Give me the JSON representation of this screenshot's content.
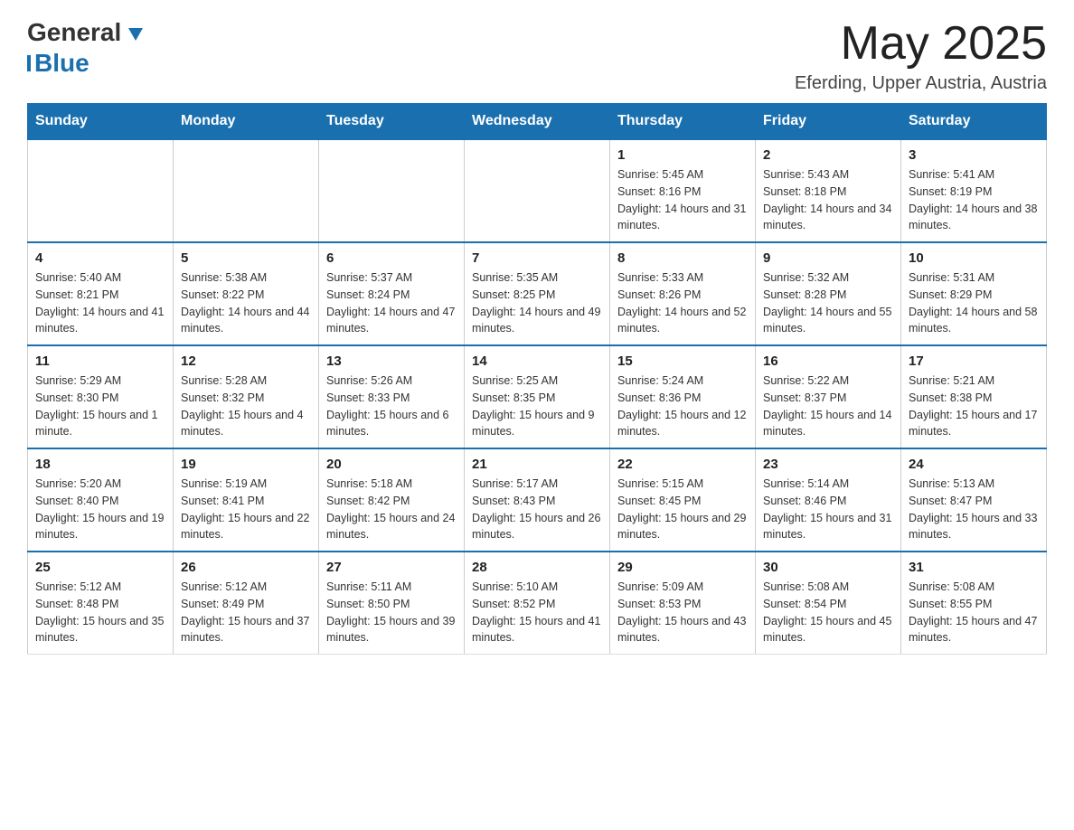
{
  "header": {
    "logo_text_black": "General",
    "logo_text_blue": "Blue",
    "month_title": "May 2025",
    "location": "Eferding, Upper Austria, Austria"
  },
  "days_of_week": [
    "Sunday",
    "Monday",
    "Tuesday",
    "Wednesday",
    "Thursday",
    "Friday",
    "Saturday"
  ],
  "weeks": [
    [
      {
        "day": "",
        "info": ""
      },
      {
        "day": "",
        "info": ""
      },
      {
        "day": "",
        "info": ""
      },
      {
        "day": "",
        "info": ""
      },
      {
        "day": "1",
        "info": "Sunrise: 5:45 AM\nSunset: 8:16 PM\nDaylight: 14 hours and 31 minutes."
      },
      {
        "day": "2",
        "info": "Sunrise: 5:43 AM\nSunset: 8:18 PM\nDaylight: 14 hours and 34 minutes."
      },
      {
        "day": "3",
        "info": "Sunrise: 5:41 AM\nSunset: 8:19 PM\nDaylight: 14 hours and 38 minutes."
      }
    ],
    [
      {
        "day": "4",
        "info": "Sunrise: 5:40 AM\nSunset: 8:21 PM\nDaylight: 14 hours and 41 minutes."
      },
      {
        "day": "5",
        "info": "Sunrise: 5:38 AM\nSunset: 8:22 PM\nDaylight: 14 hours and 44 minutes."
      },
      {
        "day": "6",
        "info": "Sunrise: 5:37 AM\nSunset: 8:24 PM\nDaylight: 14 hours and 47 minutes."
      },
      {
        "day": "7",
        "info": "Sunrise: 5:35 AM\nSunset: 8:25 PM\nDaylight: 14 hours and 49 minutes."
      },
      {
        "day": "8",
        "info": "Sunrise: 5:33 AM\nSunset: 8:26 PM\nDaylight: 14 hours and 52 minutes."
      },
      {
        "day": "9",
        "info": "Sunrise: 5:32 AM\nSunset: 8:28 PM\nDaylight: 14 hours and 55 minutes."
      },
      {
        "day": "10",
        "info": "Sunrise: 5:31 AM\nSunset: 8:29 PM\nDaylight: 14 hours and 58 minutes."
      }
    ],
    [
      {
        "day": "11",
        "info": "Sunrise: 5:29 AM\nSunset: 8:30 PM\nDaylight: 15 hours and 1 minute."
      },
      {
        "day": "12",
        "info": "Sunrise: 5:28 AM\nSunset: 8:32 PM\nDaylight: 15 hours and 4 minutes."
      },
      {
        "day": "13",
        "info": "Sunrise: 5:26 AM\nSunset: 8:33 PM\nDaylight: 15 hours and 6 minutes."
      },
      {
        "day": "14",
        "info": "Sunrise: 5:25 AM\nSunset: 8:35 PM\nDaylight: 15 hours and 9 minutes."
      },
      {
        "day": "15",
        "info": "Sunrise: 5:24 AM\nSunset: 8:36 PM\nDaylight: 15 hours and 12 minutes."
      },
      {
        "day": "16",
        "info": "Sunrise: 5:22 AM\nSunset: 8:37 PM\nDaylight: 15 hours and 14 minutes."
      },
      {
        "day": "17",
        "info": "Sunrise: 5:21 AM\nSunset: 8:38 PM\nDaylight: 15 hours and 17 minutes."
      }
    ],
    [
      {
        "day": "18",
        "info": "Sunrise: 5:20 AM\nSunset: 8:40 PM\nDaylight: 15 hours and 19 minutes."
      },
      {
        "day": "19",
        "info": "Sunrise: 5:19 AM\nSunset: 8:41 PM\nDaylight: 15 hours and 22 minutes."
      },
      {
        "day": "20",
        "info": "Sunrise: 5:18 AM\nSunset: 8:42 PM\nDaylight: 15 hours and 24 minutes."
      },
      {
        "day": "21",
        "info": "Sunrise: 5:17 AM\nSunset: 8:43 PM\nDaylight: 15 hours and 26 minutes."
      },
      {
        "day": "22",
        "info": "Sunrise: 5:15 AM\nSunset: 8:45 PM\nDaylight: 15 hours and 29 minutes."
      },
      {
        "day": "23",
        "info": "Sunrise: 5:14 AM\nSunset: 8:46 PM\nDaylight: 15 hours and 31 minutes."
      },
      {
        "day": "24",
        "info": "Sunrise: 5:13 AM\nSunset: 8:47 PM\nDaylight: 15 hours and 33 minutes."
      }
    ],
    [
      {
        "day": "25",
        "info": "Sunrise: 5:12 AM\nSunset: 8:48 PM\nDaylight: 15 hours and 35 minutes."
      },
      {
        "day": "26",
        "info": "Sunrise: 5:12 AM\nSunset: 8:49 PM\nDaylight: 15 hours and 37 minutes."
      },
      {
        "day": "27",
        "info": "Sunrise: 5:11 AM\nSunset: 8:50 PM\nDaylight: 15 hours and 39 minutes."
      },
      {
        "day": "28",
        "info": "Sunrise: 5:10 AM\nSunset: 8:52 PM\nDaylight: 15 hours and 41 minutes."
      },
      {
        "day": "29",
        "info": "Sunrise: 5:09 AM\nSunset: 8:53 PM\nDaylight: 15 hours and 43 minutes."
      },
      {
        "day": "30",
        "info": "Sunrise: 5:08 AM\nSunset: 8:54 PM\nDaylight: 15 hours and 45 minutes."
      },
      {
        "day": "31",
        "info": "Sunrise: 5:08 AM\nSunset: 8:55 PM\nDaylight: 15 hours and 47 minutes."
      }
    ]
  ]
}
